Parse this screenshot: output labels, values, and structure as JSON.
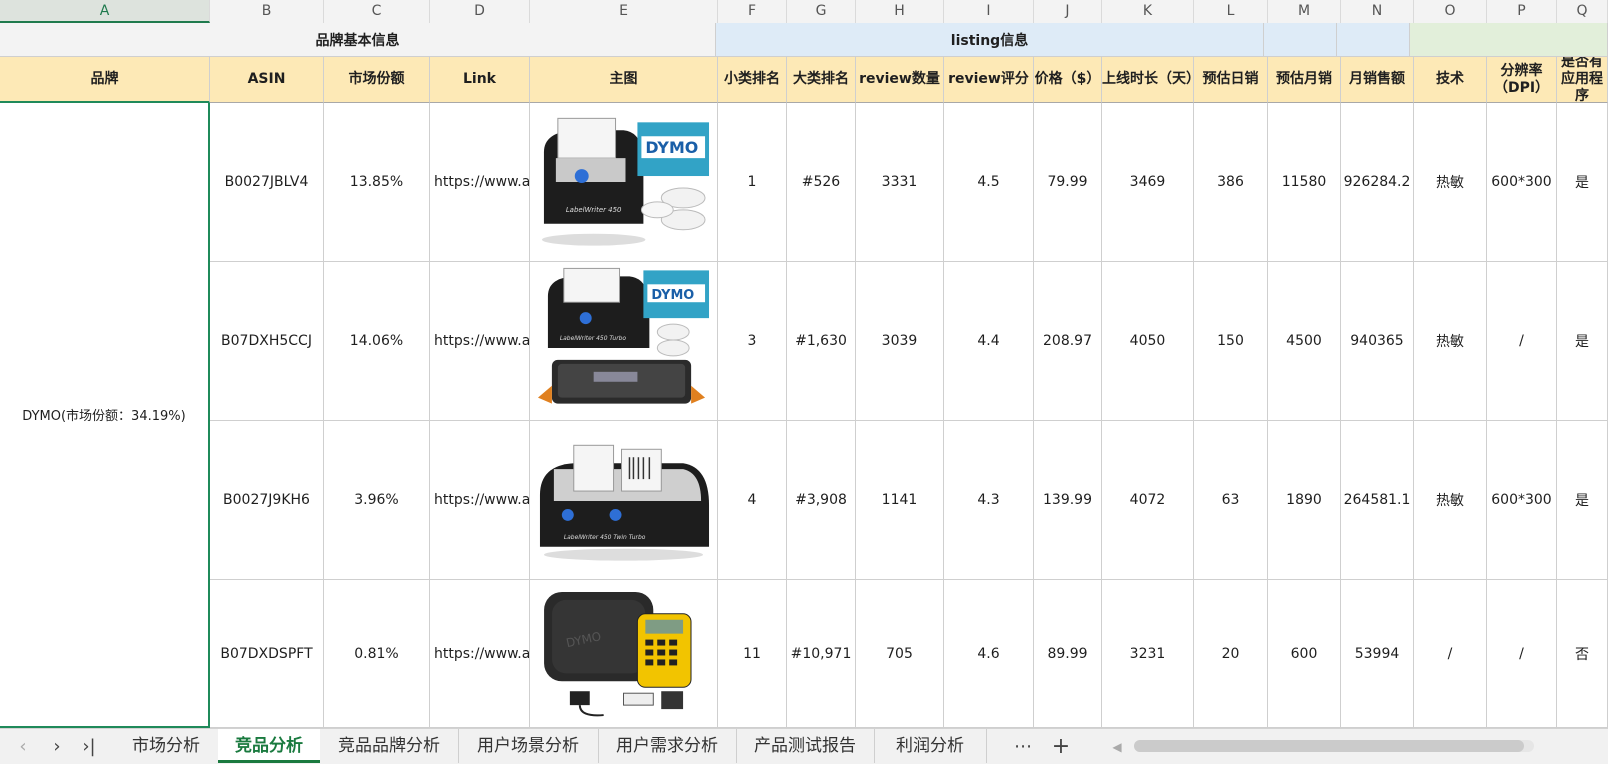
{
  "columns": [
    "A",
    "B",
    "C",
    "D",
    "E",
    "F",
    "G",
    "H",
    "I",
    "J",
    "K",
    "L",
    "M",
    "N",
    "O",
    "P",
    "Q"
  ],
  "groups": {
    "basic": "品牌基本信息",
    "listing": "listing信息"
  },
  "headers": {
    "brand": "品牌",
    "asin": "ASIN",
    "share": "市场份额",
    "link": "Link",
    "image": "主图",
    "sub_rank": "小类排名",
    "main_rank": "大类排名",
    "review_count": "review数量",
    "review_score": "review评分",
    "price": "价格（$）",
    "days_online": "上线时长（天）",
    "daily_sales": "预估日销",
    "monthly_sales": "预估月销",
    "monthly_revenue": "月销售额",
    "tech": "技术",
    "dpi": "分辨率（DPI）",
    "app": "是否有应用程序"
  },
  "brand": "DYMO(市场份额：34.19%)",
  "rows": [
    {
      "asin": "B0027JBLV4",
      "share": "13.85%",
      "link": "https://www.an",
      "sub_rank": "1",
      "main_rank": "#526",
      "review_count": "3331",
      "review_score": "4.5",
      "price": "79.99",
      "days_online": "3469",
      "daily_sales": "386",
      "monthly_sales": "11580",
      "monthly_revenue": "926284.2",
      "tech": "热敏",
      "dpi": "600*300",
      "app": "是"
    },
    {
      "asin": "B07DXH5CCJ",
      "share": "14.06%",
      "link": "https://www.an",
      "sub_rank": "3",
      "main_rank": "#1,630",
      "review_count": "3039",
      "review_score": "4.4",
      "price": "208.97",
      "days_online": "4050",
      "daily_sales": "150",
      "monthly_sales": "4500",
      "monthly_revenue": "940365",
      "tech": "热敏",
      "dpi": "/",
      "app": "是"
    },
    {
      "asin": "B0027J9KH6",
      "share": "3.96%",
      "link": "https://www.an",
      "sub_rank": "4",
      "main_rank": "#3,908",
      "review_count": "1141",
      "review_score": "4.3",
      "price": "139.99",
      "days_online": "4072",
      "daily_sales": "63",
      "monthly_sales": "1890",
      "monthly_revenue": "264581.1",
      "tech": "热敏",
      "dpi": "600*300",
      "app": "是"
    },
    {
      "asin": "B07DXDSPFT",
      "share": "0.81%",
      "link": "https://www.an",
      "sub_rank": "11",
      "main_rank": "#10,971",
      "review_count": "705",
      "review_score": "4.6",
      "price": "89.99",
      "days_online": "3231",
      "daily_sales": "20",
      "monthly_sales": "600",
      "monthly_revenue": "53994",
      "tech": "/",
      "dpi": "/",
      "app": "否"
    }
  ],
  "image_text": {
    "box_brand": "DYMO",
    "model_1": "LabelWriter 450",
    "model_2": "LabelWriter 450 Turbo",
    "model_3": "LabelWriter 450 Twin Turbo"
  },
  "tabs": [
    "市场分析",
    "竞品分析",
    "竞品品牌分析",
    "用户场景分析",
    "用户需求分析",
    "产品测试报告",
    "利润分析"
  ],
  "tab_more": "⋯",
  "tab_add": "+",
  "colors": {
    "header_fill": "#fde9b6",
    "listing_fill": "#deebf7",
    "selection": "#1f8a5a",
    "active_tab": "#1a7a3f"
  }
}
